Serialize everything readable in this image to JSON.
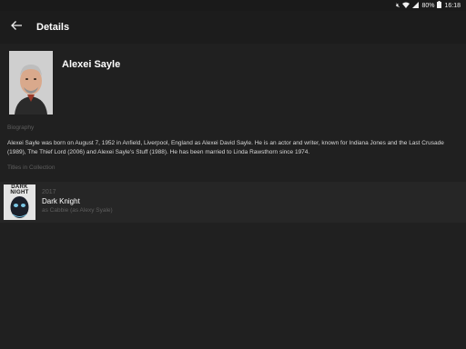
{
  "status_bar": {
    "battery": "80%",
    "time": "16:18"
  },
  "app_bar": {
    "title": "Details",
    "back_icon": "arrow-left-icon"
  },
  "person": {
    "name": "Alexei Sayle",
    "portrait_icon": "person-portrait"
  },
  "sections": {
    "biography_label": "Biography",
    "biography_text": "Alexei Sayle was born on August 7, 1952 in Anfield, Liverpool, England as Alexei David Sayle. He is an actor and writer, known for Indiana Jones and the Last Crusade (1989), The Thief Lord (2006) and Alexei Sayle's Stuff (1988). He has been married to Linda Rawsthorn since 1974.",
    "collection_label": "Titles in Collection"
  },
  "collection": [
    {
      "year": "2017",
      "title": "Dark Knight",
      "role": "as Cabbie (as Alexy Syale)",
      "poster_text": "DARK NIGHT"
    }
  ],
  "colors": {
    "background": "#202020",
    "app_bar": "#1c1c1c",
    "row_background": "#262626",
    "muted_text": "#5e5e5e"
  }
}
